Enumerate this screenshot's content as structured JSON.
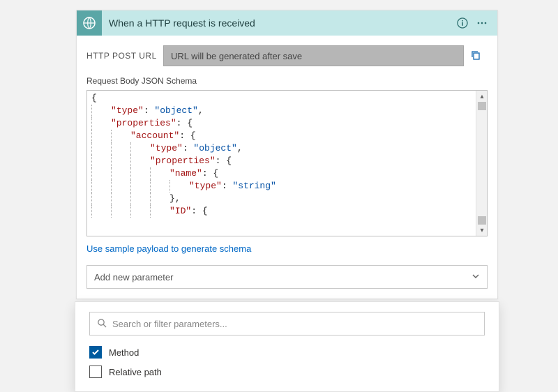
{
  "header": {
    "title": "When a HTTP request is received"
  },
  "url_row": {
    "label": "HTTP POST URL",
    "value": "URL will be generated after save"
  },
  "schema": {
    "label": "Request Body JSON Schema",
    "lines": [
      {
        "indent": 0,
        "tokens": [
          [
            "b",
            "{"
          ]
        ]
      },
      {
        "indent": 1,
        "tokens": [
          [
            "k",
            "\"type\""
          ],
          [
            "p",
            ": "
          ],
          [
            "s",
            "\"object\""
          ],
          [
            "p",
            ","
          ]
        ]
      },
      {
        "indent": 1,
        "tokens": [
          [
            "k",
            "\"properties\""
          ],
          [
            "p",
            ": "
          ],
          [
            "b",
            "{"
          ]
        ]
      },
      {
        "indent": 2,
        "tokens": [
          [
            "k",
            "\"account\""
          ],
          [
            "p",
            ": "
          ],
          [
            "b",
            "{"
          ]
        ]
      },
      {
        "indent": 3,
        "tokens": [
          [
            "k",
            "\"type\""
          ],
          [
            "p",
            ": "
          ],
          [
            "s",
            "\"object\""
          ],
          [
            "p",
            ","
          ]
        ]
      },
      {
        "indent": 3,
        "tokens": [
          [
            "k",
            "\"properties\""
          ],
          [
            "p",
            ": "
          ],
          [
            "b",
            "{"
          ]
        ]
      },
      {
        "indent": 4,
        "tokens": [
          [
            "k",
            "\"name\""
          ],
          [
            "p",
            ": "
          ],
          [
            "b",
            "{"
          ]
        ]
      },
      {
        "indent": 5,
        "tokens": [
          [
            "k",
            "\"type\""
          ],
          [
            "p",
            ": "
          ],
          [
            "s",
            "\"string\""
          ]
        ]
      },
      {
        "indent": 4,
        "tokens": [
          [
            "b",
            "}"
          ],
          [
            "p",
            ","
          ]
        ]
      },
      {
        "indent": 4,
        "tokens": [
          [
            "k",
            "\"ID\""
          ],
          [
            "p",
            ": "
          ],
          [
            "b",
            "{"
          ]
        ]
      }
    ]
  },
  "sample_link": "Use sample payload to generate schema",
  "add_param": {
    "label": "Add new parameter"
  },
  "dropdown": {
    "search_placeholder": "Search or filter parameters...",
    "options": [
      {
        "label": "Method",
        "checked": true
      },
      {
        "label": "Relative path",
        "checked": false
      }
    ]
  }
}
